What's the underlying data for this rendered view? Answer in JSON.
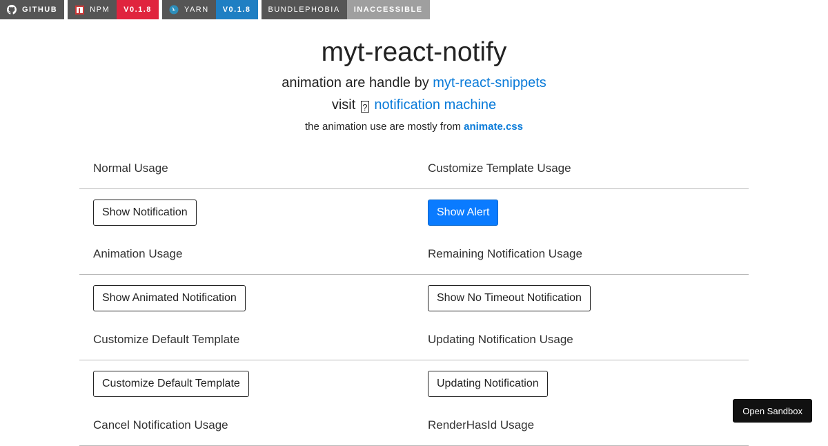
{
  "badges": [
    {
      "icon": "github-icon",
      "label": "GITHUB"
    },
    {
      "icon": "npm-icon",
      "label": "NPM",
      "value": "V0.1.8"
    },
    {
      "icon": "yarn-icon",
      "label": "YARN",
      "value": "V0.1.8"
    },
    {
      "label": "BUNDLEPHOBIA",
      "value": "INACCESSIBLE"
    }
  ],
  "header": {
    "title": "myt-react-notify",
    "line1_text": "animation are handle by",
    "line1_link": "myt-react-snippets",
    "line2_text": "visit",
    "line2_icon": "?",
    "line2_link": "notification machine",
    "line3_text": "the animation use are mostly from",
    "line3_link": "animate.css"
  },
  "sections": [
    {
      "left": {
        "heading": "Normal Usage",
        "button": "Show Notification"
      },
      "right": {
        "heading": "Customize Template Usage",
        "button": "Show Alert"
      }
    },
    {
      "left": {
        "heading": "Animation Usage",
        "button": "Show Animated Notification"
      },
      "right": {
        "heading": "Remaining Notification Usage",
        "button": "Show No Timeout Notification"
      }
    },
    {
      "left": {
        "heading": "Customize Default Template",
        "button": "Customize Default Template"
      },
      "right": {
        "heading": "Updating Notification Usage",
        "button": "Updating Notification"
      }
    },
    {
      "left": {
        "heading": "Cancel Notification Usage"
      },
      "right": {
        "heading": "RenderHasId Usage"
      }
    }
  ],
  "sandbox_label": "Open Sandbox",
  "colors": {
    "link": "#0a7bd9",
    "primary_button": "#0a7bff",
    "npm_badge": "#e0243e",
    "yarn_badge": "#1f7fc3"
  }
}
